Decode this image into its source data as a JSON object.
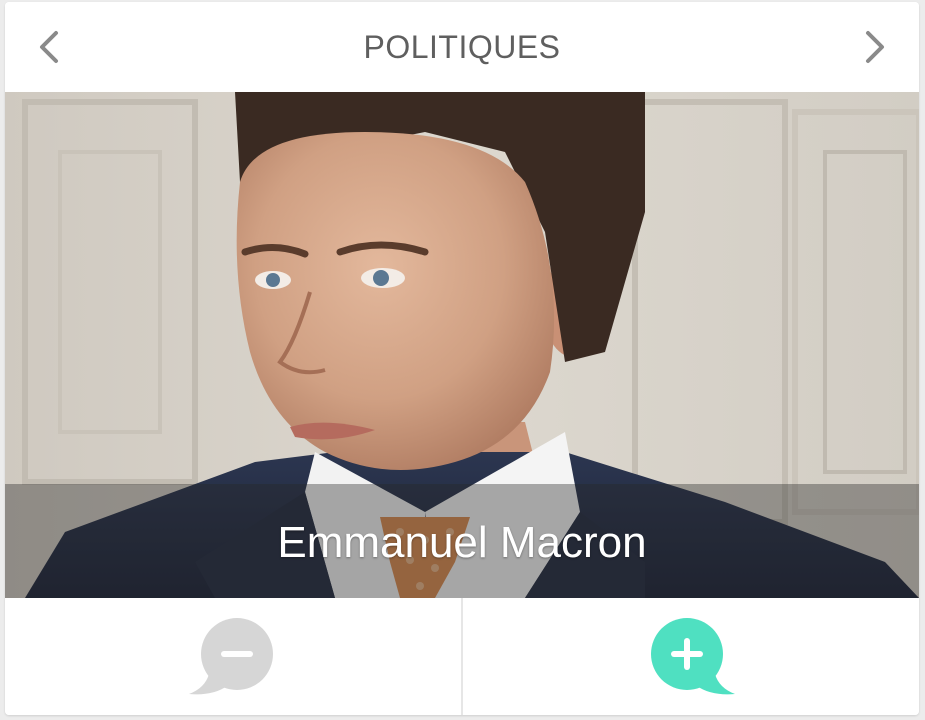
{
  "header": {
    "title": "POLITIQUES",
    "prev_icon": "chevron-left-icon",
    "next_icon": "chevron-right-icon"
  },
  "card": {
    "person_name": "Emmanuel Macron",
    "photo": "portrait-photo"
  },
  "votes": {
    "minus_icon": "minus-bubble-icon",
    "plus_icon": "plus-bubble-icon",
    "minus_color": "#d6d6d6",
    "plus_color": "#4fe0c1"
  },
  "colors": {
    "title": "#5f5f5f",
    "chevron": "#8a8a8a",
    "background": "#ececec"
  }
}
